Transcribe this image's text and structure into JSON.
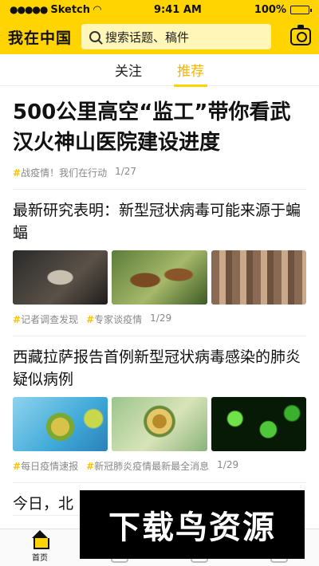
{
  "status_bar": {
    "carrier": "Sketch",
    "time": "9:41 AM",
    "battery": "100%"
  },
  "header": {
    "logo": "我在中国",
    "search_placeholder": "搜索话题、稿件"
  },
  "tabs": [
    {
      "label": "关注"
    },
    {
      "label": "推荐"
    }
  ],
  "feed": [
    {
      "title": "500公里高空“监工”带你看武汉火神山医院建设进度",
      "tags": [
        "战疫情！我们在行动"
      ],
      "date": "1/27"
    },
    {
      "title": "最新研究表明：新型冠状病毒可能来源于蝙蝠",
      "tags": [
        "记者调查发现",
        "专家谈疫情"
      ],
      "date": "1/29"
    },
    {
      "title": "西藏拉萨报告首例新型冠状病毒感染的肺炎疑似病例",
      "tags": [
        "每日疫情速报",
        "新冠肺炎疫情最新最全消息"
      ],
      "date": "1/29"
    },
    {
      "title": "今日，北"
    }
  ],
  "bottom_nav": [
    {
      "label": "首页"
    }
  ],
  "watermark": "下载鸟资源",
  "colors": {
    "accent": "#FFD400",
    "active_tab": "#F2B600"
  }
}
